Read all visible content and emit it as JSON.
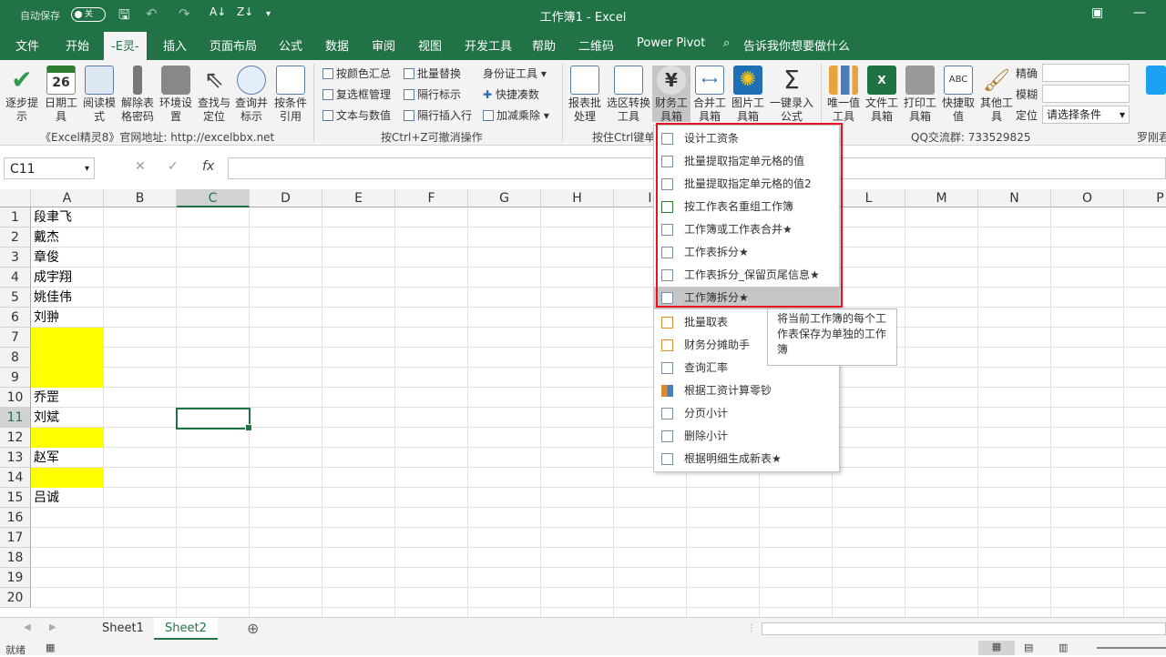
{
  "title": {
    "autosave": "自动保存",
    "toggle": "关",
    "center": "工作簿1  -  Excel"
  },
  "tabs": [
    {
      "label": "文件"
    },
    {
      "label": "开始"
    },
    {
      "label": "-E灵-"
    },
    {
      "label": "插入"
    },
    {
      "label": "页面布局"
    },
    {
      "label": "公式"
    },
    {
      "label": "数据"
    },
    {
      "label": "审阅"
    },
    {
      "label": "视图"
    },
    {
      "label": "开发工具"
    },
    {
      "label": "帮助"
    },
    {
      "label": "二维码"
    },
    {
      "label": "Power Pivot"
    },
    {
      "label": "告诉我你想要做什么"
    }
  ],
  "ribbon": {
    "g1": [
      "逐步提示",
      "日期工具",
      "阅读模式",
      "解除表格密码",
      "环境设置",
      "查找与定位",
      "查询并标示",
      "按条件引用"
    ],
    "g1_caption": "《Excel精灵8》官网地址: http://excelbbx.net",
    "g2": [
      "按颜色汇总",
      "批量替换",
      "身份证工具",
      "复选框管理",
      "隔行标示",
      "快捷凑数",
      "文本与数值",
      "隔行插入行",
      "加减乘除"
    ],
    "g2_caption": "按Ctrl+Z可撤消操作",
    "g3": [
      "报表批处理",
      "选区转换工具",
      "财务工具箱",
      "合并工具箱",
      "图片工具箱",
      "一键录入公式"
    ],
    "g3_caption": "按住Ctrl键单",
    "g4": [
      "唯一值工具",
      "文件工具箱",
      "打印工具箱",
      "快捷取值",
      "其他工具"
    ],
    "g4_caption": "QQ交流群: 733529825",
    "match": [
      "精确",
      "模糊",
      "定位"
    ],
    "select_placeholder": "请选择条件",
    "right_caption": "罗刚君"
  },
  "namebox": "C11",
  "columns": [
    "A",
    "B",
    "C",
    "D",
    "E",
    "F",
    "G",
    "H",
    "I",
    "J",
    "K",
    "L",
    "M",
    "N",
    "O",
    "P"
  ],
  "rows": [
    "1",
    "2",
    "3",
    "4",
    "5",
    "6",
    "7",
    "8",
    "9",
    "10",
    "11",
    "12",
    "13",
    "14",
    "15",
    "16",
    "17",
    "18",
    "19",
    "20"
  ],
  "cells": [
    "段聿飞",
    "戴杰",
    "章俊",
    "成宇翔",
    "姚佳伟",
    "刘翀",
    "",
    "",
    "",
    "乔罡",
    "刘斌",
    "",
    "赵军",
    "",
    "吕诚"
  ],
  "menu": [
    "设计工资条",
    "批量提取指定单元格的值",
    "批量提取指定单元格的值2",
    "按工作表名重组工作簿",
    "工作簿或工作表合并★",
    "工作表拆分★",
    "工作表拆分_保留页尾信息★",
    "工作簿拆分★",
    "批量取表",
    "财务分摊助手",
    "查询汇率",
    "根据工资计算零钞",
    "分页小计",
    "删除小计",
    "根据明细生成新表★"
  ],
  "tooltip": "将当前工作簿的每个工作表保存为单独的工作簿",
  "sheets": [
    "Sheet1",
    "Sheet2"
  ],
  "status": "就绪",
  "colors": {
    "accent": "#217346",
    "highlight": "#ffff00",
    "redbox": "#e81123"
  }
}
